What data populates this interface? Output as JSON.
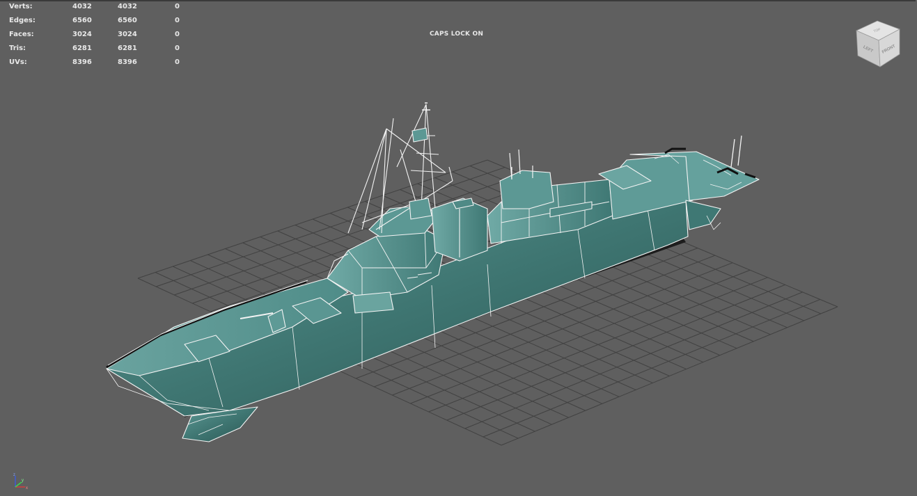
{
  "stats": [
    {
      "label": "Verts:",
      "v1": "4032",
      "v2": "4032",
      "v3": "0"
    },
    {
      "label": "Edges:",
      "v1": "6560",
      "v2": "6560",
      "v3": "0"
    },
    {
      "label": "Faces:",
      "v1": "3024",
      "v2": "3024",
      "v3": "0"
    },
    {
      "label": "Tris:",
      "v1": "6281",
      "v2": "6281",
      "v3": "0"
    },
    {
      "label": "UVs:",
      "v1": "8396",
      "v2": "8396",
      "v3": "0"
    }
  ],
  "caps_lock": "CAPS LOCK ON",
  "viewcube": {
    "top": "TOP",
    "left": "LEFT",
    "front": "FRONT"
  },
  "axis": {
    "x": "x",
    "y": "y",
    "z": "z"
  },
  "colors": {
    "background": "#5f5f5f",
    "grid": "#3f3f3f",
    "hull_dark": "#2f5f5f",
    "hull_light": "#6aa09c",
    "wire": "#ffffff"
  }
}
